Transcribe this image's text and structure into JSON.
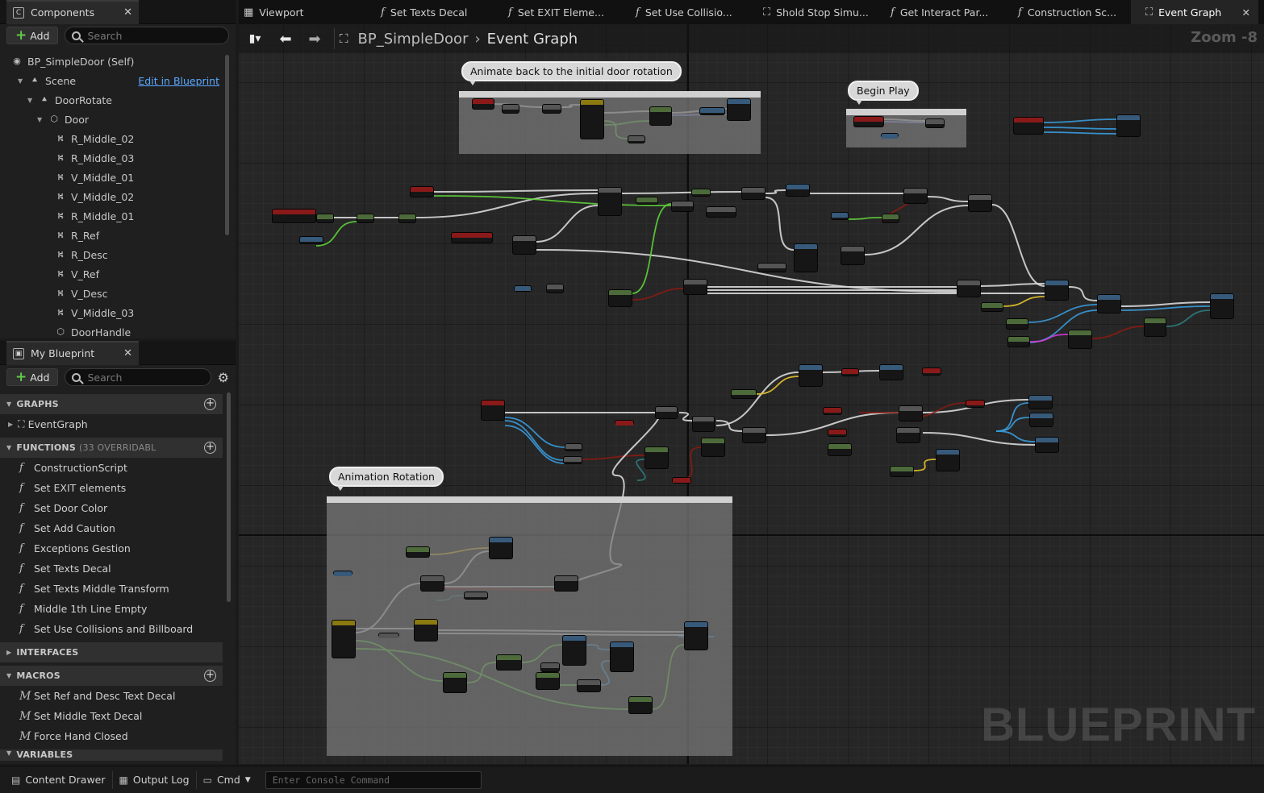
{
  "components_panel": {
    "tab_title": "Components",
    "add_label": "Add",
    "search_placeholder": "Search",
    "edit_link": "Edit in Blueprint",
    "tree": [
      {
        "label": "BP_SimpleDoor (Self)",
        "indent": 0,
        "icon": "actor-icon"
      },
      {
        "label": "Scene",
        "indent": 1,
        "icon": "scene-icon",
        "expanded": true
      },
      {
        "label": "DoorRotate",
        "indent": 2,
        "icon": "scene-icon",
        "expanded": true
      },
      {
        "label": "Door",
        "indent": 3,
        "icon": "mesh-icon",
        "expanded": true
      },
      {
        "label": "R_Middle_02",
        "indent": 4,
        "icon": "text-render-icon"
      },
      {
        "label": "R_Middle_03",
        "indent": 4,
        "icon": "text-render-icon"
      },
      {
        "label": "V_Middle_01",
        "indent": 4,
        "icon": "text-render-icon"
      },
      {
        "label": "V_Middle_02",
        "indent": 4,
        "icon": "text-render-icon"
      },
      {
        "label": "R_Middle_01",
        "indent": 4,
        "icon": "text-render-icon"
      },
      {
        "label": "R_Ref",
        "indent": 4,
        "icon": "text-render-icon"
      },
      {
        "label": "R_Desc",
        "indent": 4,
        "icon": "text-render-icon"
      },
      {
        "label": "V_Ref",
        "indent": 4,
        "icon": "text-render-icon"
      },
      {
        "label": "V_Desc",
        "indent": 4,
        "icon": "text-render-icon"
      },
      {
        "label": "V_Middle_03",
        "indent": 4,
        "icon": "text-render-icon"
      },
      {
        "label": "DoorHandle",
        "indent": 4,
        "icon": "mesh-icon"
      }
    ]
  },
  "my_blueprint": {
    "tab_title": "My Blueprint",
    "add_label": "Add",
    "search_placeholder": "Search",
    "graphs_header": "GRAPHS",
    "graphs": [
      "EventGraph"
    ],
    "functions_header": "FUNCTIONS",
    "functions_note": "(33 OVERRIDABL",
    "functions": [
      "ConstructionScript",
      "Set EXIT elements",
      "Set Door Color",
      "Set Add Caution",
      "Exceptions Gestion",
      "Set Texts Decal",
      "Set Texts Middle Transform",
      "Middle 1th Line Empty",
      "Set Use Collisions and Billboard"
    ],
    "interfaces_header": "INTERFACES",
    "macros_header": "MACROS",
    "macros": [
      "Set Ref and Desc Text Decal",
      "Set Middle Text Decal",
      "Force Hand Closed"
    ],
    "variables_header": "VARIABLES"
  },
  "doc_tabs": [
    {
      "label": "Viewport",
      "icon": "viewport-icon",
      "active": false
    },
    {
      "label": "Set Texts Decal",
      "icon": "function-icon",
      "active": false
    },
    {
      "label": "Set EXIT Eleme...",
      "icon": "function-icon",
      "active": false
    },
    {
      "label": "Set Use Collisio...",
      "icon": "function-icon",
      "active": false
    },
    {
      "label": "Shold Stop Simu...",
      "icon": "graph-icon",
      "active": false
    },
    {
      "label": "Get Interact Par...",
      "icon": "function-icon",
      "active": false
    },
    {
      "label": "Construction Sc...",
      "icon": "function-icon",
      "active": false
    },
    {
      "label": "Event Graph",
      "icon": "graph-icon",
      "active": true
    }
  ],
  "graph_toolbar": {
    "breadcrumb_root": "BP_SimpleDoor",
    "breadcrumb_leaf": "Event Graph",
    "zoom": "Zoom -8"
  },
  "comments": {
    "animate_back": "Animate back to the initial door rotation",
    "begin_play": "Begin Play",
    "animation_rotation": "Animation Rotation"
  },
  "watermark": "BLUEPRINT",
  "bottom_bar": {
    "content_drawer": "Content Drawer",
    "output_log": "Output Log",
    "cmd": "Cmd",
    "console_placeholder": "Enter Console Command"
  },
  "colors": {
    "exec_wire": "#d8d8d8",
    "float_wire": "#5fd13a",
    "object_wire": "#3a9bdc",
    "bool_wire": "#8a1b12",
    "vector_wire": "#e6c22c",
    "rotator_wire": "#8f9bff",
    "struct_wire": "#2f7a7a",
    "pink_wire": "#d43ad8",
    "event_node": "#8a1a1a",
    "function_node": "#375a7a",
    "pure_node": "#4d6b3a",
    "macro_node": "#555555",
    "timeline_node": "#8a7a10"
  }
}
